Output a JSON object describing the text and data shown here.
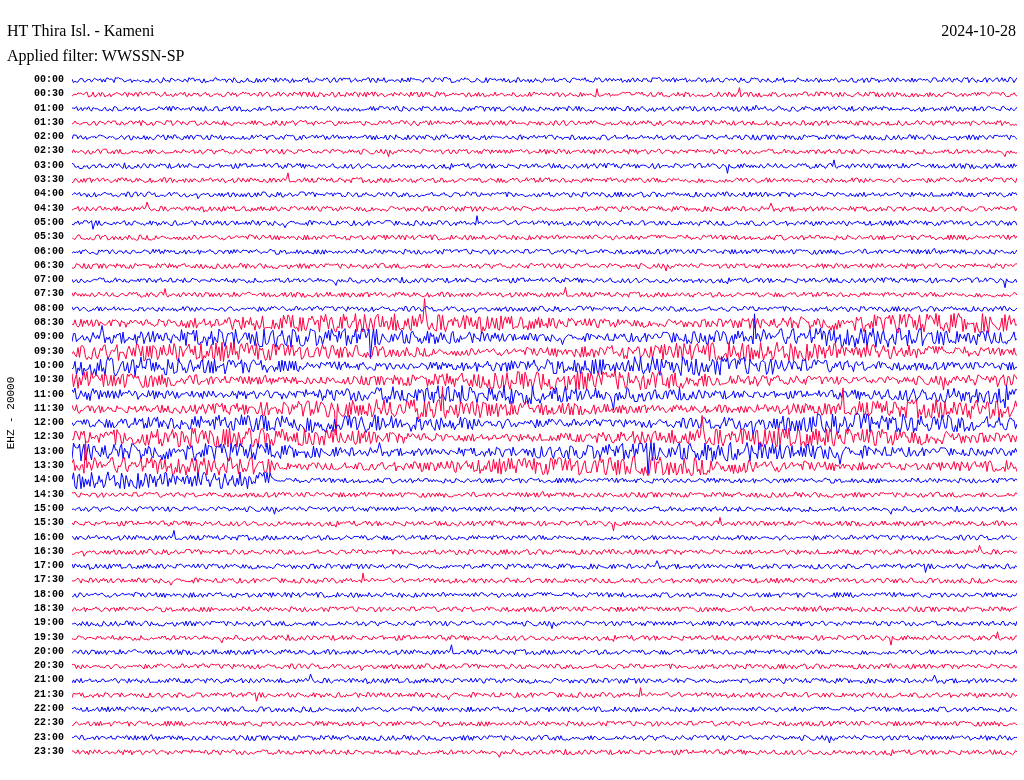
{
  "header": {
    "station": "HT Thira Isl. - Kameni",
    "date": "2024-10-28",
    "filter": "Applied filter: WWSSN-SP"
  },
  "channel_label": "EHZ - 20000",
  "rows": [
    {
      "time": "00:00",
      "color": "#0000ff"
    },
    {
      "time": "00:30",
      "color": "#ff0040"
    },
    {
      "time": "01:00",
      "color": "#0000ff"
    },
    {
      "time": "01:30",
      "color": "#ff0040"
    },
    {
      "time": "02:00",
      "color": "#0000ff"
    },
    {
      "time": "02:30",
      "color": "#ff0040"
    },
    {
      "time": "03:00",
      "color": "#0000ff"
    },
    {
      "time": "03:30",
      "color": "#ff0040"
    },
    {
      "time": "04:00",
      "color": "#0000ff"
    },
    {
      "time": "04:30",
      "color": "#ff0040"
    },
    {
      "time": "05:00",
      "color": "#0000ff"
    },
    {
      "time": "05:30",
      "color": "#ff0040"
    },
    {
      "time": "06:00",
      "color": "#0000ff"
    },
    {
      "time": "06:30",
      "color": "#ff0040"
    },
    {
      "time": "07:00",
      "color": "#0000ff"
    },
    {
      "time": "07:30",
      "color": "#ff0040"
    },
    {
      "time": "08:00",
      "color": "#0000ff"
    },
    {
      "time": "08:30",
      "color": "#ff0040"
    },
    {
      "time": "09:00",
      "color": "#0000ff"
    },
    {
      "time": "09:30",
      "color": "#ff0040"
    },
    {
      "time": "10:00",
      "color": "#0000ff"
    },
    {
      "time": "10:30",
      "color": "#ff0040"
    },
    {
      "time": "11:00",
      "color": "#0000ff"
    },
    {
      "time": "11:30",
      "color": "#ff0040"
    },
    {
      "time": "12:00",
      "color": "#0000ff"
    },
    {
      "time": "12:30",
      "color": "#ff0040"
    },
    {
      "time": "13:00",
      "color": "#0000ff"
    },
    {
      "time": "13:30",
      "color": "#ff0040"
    },
    {
      "time": "14:00",
      "color": "#0000ff"
    },
    {
      "time": "14:30",
      "color": "#ff0040"
    },
    {
      "time": "15:00",
      "color": "#0000ff"
    },
    {
      "time": "15:30",
      "color": "#ff0040"
    },
    {
      "time": "16:00",
      "color": "#0000ff"
    },
    {
      "time": "16:30",
      "color": "#ff0040"
    },
    {
      "time": "17:00",
      "color": "#0000ff"
    },
    {
      "time": "17:30",
      "color": "#ff0040"
    },
    {
      "time": "18:00",
      "color": "#0000ff"
    },
    {
      "time": "18:30",
      "color": "#ff0040"
    },
    {
      "time": "19:00",
      "color": "#0000ff"
    },
    {
      "time": "19:30",
      "color": "#ff0040"
    },
    {
      "time": "20:00",
      "color": "#0000ff"
    },
    {
      "time": "20:30",
      "color": "#ff0040"
    },
    {
      "time": "21:00",
      "color": "#0000ff"
    },
    {
      "time": "21:30",
      "color": "#ff0040"
    },
    {
      "time": "22:00",
      "color": "#0000ff"
    },
    {
      "time": "22:30",
      "color": "#ff0040"
    },
    {
      "time": "23:00",
      "color": "#0000ff"
    },
    {
      "time": "23:30",
      "color": "#ff0040"
    }
  ]
}
